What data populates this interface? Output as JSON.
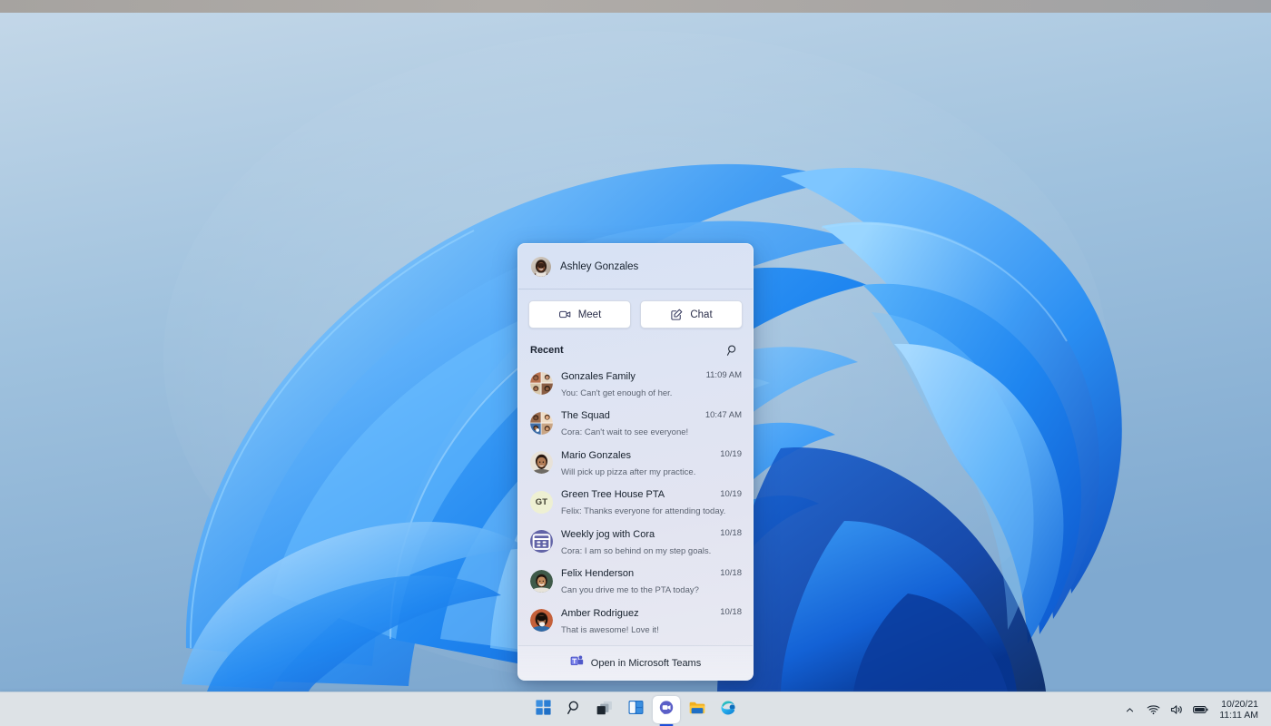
{
  "desktop": {
    "wallpaper_name": "windows-11-bloom-wallpaper",
    "colors": {
      "sky": "#8fb5d6",
      "bloom_blue": "#1f86f0",
      "bloom_deep": "#0a3fa8"
    }
  },
  "flyout": {
    "name": "chat-flyout",
    "account": {
      "display_name": "Ashley Gonzales",
      "avatar_name": "avatar-ashley-gonzales"
    },
    "actions": [
      {
        "label": "Meet",
        "icon": "video-camera-icon",
        "name": "meet-button"
      },
      {
        "label": "Chat",
        "icon": "compose-message-icon",
        "name": "chat-button"
      }
    ],
    "recent": {
      "label": "Recent",
      "search_icon": "search-icon"
    },
    "conversations": [
      {
        "title": "Gonzales Family",
        "preview": "You: Can't get enough of her.",
        "time": "11:09 AM",
        "avatar_kind": "group-photo",
        "avatar_name": "avatar-gonzales-family"
      },
      {
        "title": "The Squad",
        "preview": "Cora: Can't wait to see everyone!",
        "time": "10:47 AM",
        "avatar_kind": "group-photo",
        "avatar_name": "avatar-the-squad"
      },
      {
        "title": "Mario Gonzales",
        "preview": "Will pick up pizza after my practice.",
        "time": "10/19",
        "avatar_kind": "photo-man",
        "avatar_name": "avatar-mario-gonzales"
      },
      {
        "title": "Green Tree House PTA",
        "preview": "Felix: Thanks everyone for attending today.",
        "time": "10/19",
        "avatar_kind": "initials",
        "initials": "GT",
        "avatar_color": "#eef0d3",
        "avatar_name": "avatar-green-tree-house-pta"
      },
      {
        "title": "Weekly jog with Cora",
        "preview": "Cora: I am so behind on my step goals.",
        "time": "10/18",
        "avatar_kind": "calendar-icon",
        "avatar_color": "#6264a7",
        "avatar_name": "avatar-weekly-jog-with-cora"
      },
      {
        "title": "Felix Henderson",
        "preview": "Can you drive me to the PTA today?",
        "time": "10/18",
        "avatar_kind": "photo-man2",
        "avatar_name": "avatar-felix-henderson"
      },
      {
        "title": "Amber Rodriguez",
        "preview": "That is awesome! Love it!",
        "time": "10/18",
        "avatar_kind": "photo-woman",
        "avatar_name": "avatar-amber-rodriguez"
      }
    ],
    "footer": {
      "label": "Open in Microsoft Teams",
      "icon": "microsoft-teams-icon"
    }
  },
  "taskbar": {
    "buttons": [
      {
        "name": "start-button",
        "icon": "windows-start-icon",
        "label": "Start",
        "active": false
      },
      {
        "name": "search-button",
        "icon": "search-icon",
        "label": "Search",
        "active": false
      },
      {
        "name": "task-view-button",
        "icon": "task-view-icon",
        "label": "Task View",
        "active": false
      },
      {
        "name": "widgets-button",
        "icon": "widgets-icon",
        "label": "Widgets",
        "active": false
      },
      {
        "name": "chat-taskbar-button",
        "icon": "teams-chat-icon",
        "label": "Chat",
        "active": true
      },
      {
        "name": "file-explorer-button",
        "icon": "file-explorer-icon",
        "label": "File Explorer",
        "active": false
      },
      {
        "name": "edge-button",
        "icon": "microsoft-edge-icon",
        "label": "Microsoft Edge",
        "active": false
      }
    ],
    "tray": {
      "overflow_icon": "chevron-up-icon",
      "network_icon": "wifi-icon",
      "volume_icon": "speaker-icon",
      "battery_icon": "battery-icon",
      "date": "10/20/21",
      "time": "11:11 AM"
    },
    "accent_color": "#1f4fd8"
  }
}
